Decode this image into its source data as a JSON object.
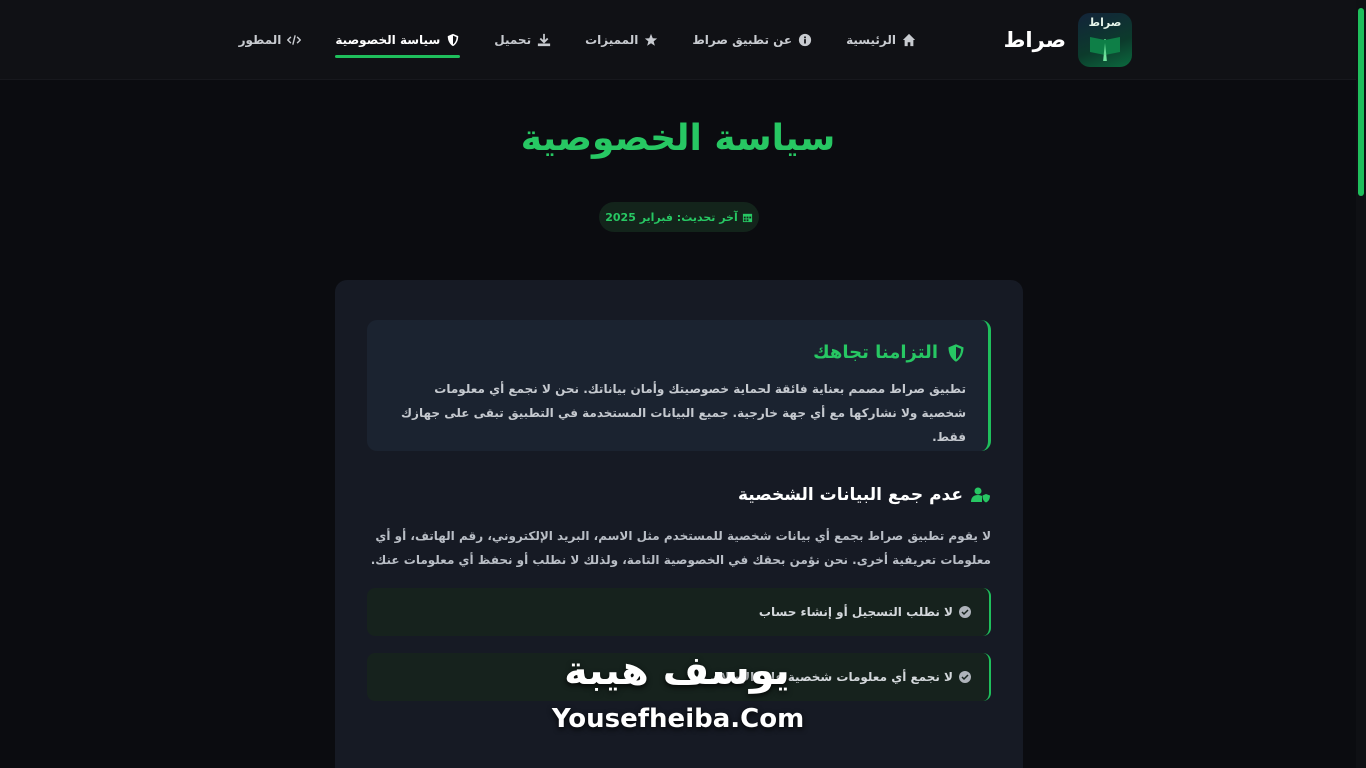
{
  "brand": {
    "name": "صراط",
    "logo_text": "صراط",
    "logo_icon": "book-icon"
  },
  "nav": {
    "items": [
      {
        "label": "الرئيسية",
        "icon": "home-icon"
      },
      {
        "label": "عن تطبيق صراط",
        "icon": "info-icon"
      },
      {
        "label": "المميزات",
        "icon": "star-icon"
      },
      {
        "label": "تحميل",
        "icon": "download-icon"
      },
      {
        "label": "سياسة الخصوصية",
        "icon": "shield-icon",
        "active": true
      },
      {
        "label": "المطور",
        "icon": "code-icon"
      }
    ]
  },
  "page": {
    "title": "سياسة الخصوصية",
    "updated": "آخر تحديث: فبراير 2025"
  },
  "commitment": {
    "title": "التزامنا تجاهك",
    "text": "تطبيق صراط مصمم بعناية فائقة لحماية خصوصيتك وأمان بياناتك. نحن لا نجمع أي معلومات شخصية ولا نشاركها مع أي جهة خارجية. جميع البيانات المستخدمة في التطبيق تبقى على جهازك فقط."
  },
  "section": {
    "title": "عدم جمع البيانات الشخصية",
    "text": "لا يقوم تطبيق صراط بجمع أي بيانات شخصية للمستخدم مثل الاسم، البريد الإلكتروني، رقم الهاتف، أو أي معلومات تعريفية أخرى. نحن نؤمن بحقك في الخصوصية التامة، ولذلك لا نطلب أو نحفظ أي معلومات عنك.",
    "items": [
      "لا نطلب التسجيل أو إنشاء حساب",
      "لا نجمع أي معلومات شخصية على الإطلاق"
    ]
  },
  "watermark": {
    "arabic": "يوسف هيبة",
    "english": "Yousefheiba.Com"
  },
  "colors": {
    "accent": "#27c763",
    "background": "#0b0c10",
    "card": "#161a24"
  }
}
